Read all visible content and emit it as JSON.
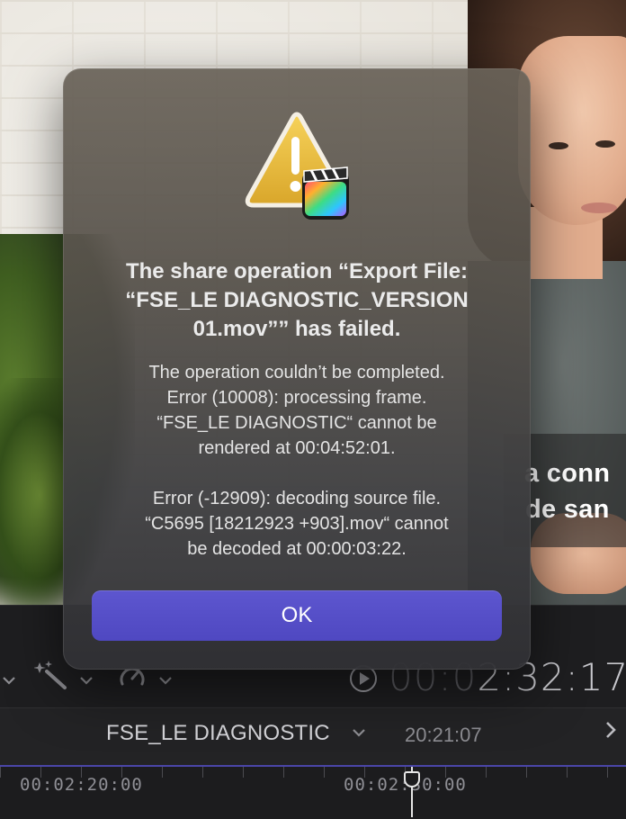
{
  "viewer": {
    "subtitle_line1": "a conn",
    "subtitle_line2": "de san"
  },
  "toolbar": {
    "icons": [
      "chevron-down-icon",
      "magic-wand-icon",
      "chevron-down-icon",
      "speed-icon",
      "chevron-down-icon",
      "play-icon"
    ],
    "timecode_dim": "00:0",
    "timecode_bright": "2:32:17"
  },
  "project": {
    "name": "FSE_LE DIAGNOSTIC",
    "duration": "20:21:07",
    "next_icon": "chevron-right-icon"
  },
  "ruler": {
    "label_left": "00:02:20:00",
    "label_right": "00:02:30:00"
  },
  "dialog": {
    "icon": "warning-triangle-with-final-cut-icon",
    "title_line1": "The share operation “Export File:",
    "title_line2": "“FSE_LE DIAGNOSTIC_VERSION",
    "title_line3": "01.mov”” has failed.",
    "body_p1_line1": "The operation couldn’t be completed.",
    "body_p1_line2": "Error (10008): processing frame.",
    "body_p1_line3": "“FSE_LE DIAGNOSTIC“ cannot be",
    "body_p1_line4": "rendered at 00:04:52:01.",
    "body_p2_line1": "Error (-12909): decoding source file.",
    "body_p2_line2": "“C5695 [18212923 +903].mov“ cannot",
    "body_p2_line3": "be decoded at 00:00:03:22.",
    "ok_label": "OK"
  },
  "colors": {
    "accent": "#5249C8",
    "warning": "#E9B93A"
  }
}
